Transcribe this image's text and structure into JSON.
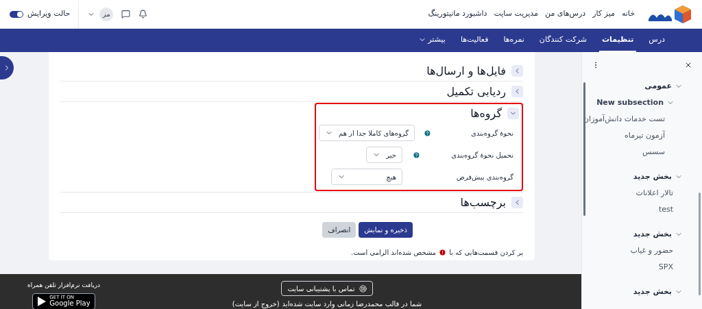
{
  "header": {
    "nav_links": [
      "خانه",
      "میز کار",
      "درس‌های من",
      "مدیریت سایت",
      "داشبورد مانیتورینگ"
    ],
    "user_initials": "مز",
    "edit_mode": {
      "label": "حالت ویرایش",
      "on": true
    }
  },
  "course_nav": [
    {
      "label": "درس",
      "selected": false
    },
    {
      "label": "تنظیمات",
      "selected": true
    },
    {
      "label": "شرکت کنندگان",
      "selected": false
    },
    {
      "label": "نمره‌ها",
      "selected": false
    },
    {
      "label": "فعالیت‌ها",
      "selected": false
    },
    {
      "label": "بیشتر",
      "selected": false,
      "kind": "dropdown"
    }
  ],
  "sections": [
    {
      "title": "فایل‌ها و ارسال‌ها",
      "expanded": false
    },
    {
      "title": "ردیابی تکمیل",
      "expanded": false
    },
    {
      "title": "گروه‌ها",
      "expanded": true,
      "highlighted": true,
      "fields": [
        {
          "label": "نحوهٔ گروه‌بندی",
          "help": true,
          "value": "گروه‌های کاملا جدا از هم"
        },
        {
          "label": "تحمیل نحوهٔ گروه‌بندی",
          "help": true,
          "value": "خیر"
        },
        {
          "label": "گروه‌بندی پیش‌فرض",
          "help": false,
          "value": "هیچ"
        }
      ]
    },
    {
      "title": "برچسب‌ها",
      "expanded": false
    }
  ],
  "buttons": [
    {
      "label": "ذخیره و نمایش",
      "kind": "primary"
    },
    {
      "label": "انصراف",
      "kind": "secondary"
    }
  ],
  "required_note": {
    "before": "پر کردن قسمت‌هایی که با",
    "after": "مشخص شده‌اند الزامی است."
  },
  "footer": {
    "support_button": "تماس با پشتیبانی سایت",
    "login_text": "شما در قالب محمدرضا زمانی وارد سایت شده‌اید",
    "logout_link": "(خروج از سایت)",
    "app_title": "دریافت نرم‌افزار تلفن همراه",
    "store_badge": {
      "small": "GET IT ON",
      "large": "Google Play"
    }
  },
  "course_index": [
    {
      "title": "عمومی",
      "expanded": true,
      "children": [
        {
          "title": "New subsection",
          "expanded": true,
          "children": [
            {
              "title": "تست خدمات دانش‌آموزان"
            },
            {
              "title": "آزمون تیرماه"
            },
            {
              "title": "سسس"
            }
          ]
        }
      ]
    },
    {
      "title": "بخش جدید",
      "expanded": true,
      "children": [
        {
          "title": "تالار اعلانات"
        },
        {
          "title": "test"
        }
      ]
    },
    {
      "title": "بخش جدید",
      "expanded": true,
      "children": [
        {
          "title": "حضور و غیاب"
        },
        {
          "title": "SPX"
        }
      ]
    },
    {
      "title": "بخش جدید",
      "expanded": true,
      "kind": "section"
    }
  ]
}
